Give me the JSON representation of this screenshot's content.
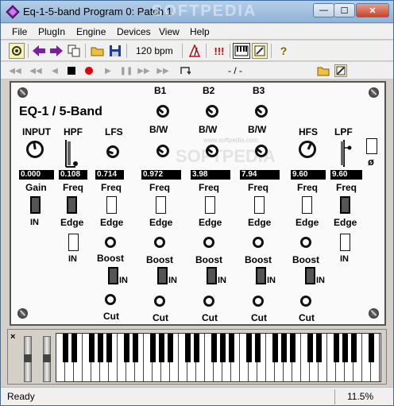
{
  "window": {
    "title": "Eq-1-5-band Program 0: Patch   1",
    "watermark": "SOFTPEDIA",
    "minimize_glyph": "—",
    "maximize_glyph": "☐",
    "close_glyph": "✕"
  },
  "menu": [
    "File",
    "PlugIn",
    "Engine",
    "Devices",
    "View",
    "Help"
  ],
  "toolbar": {
    "tempo": "120 bpm",
    "alert_label": "!!!"
  },
  "transport": {
    "position": "- / -"
  },
  "panel": {
    "title": "EQ-1 / 5-Band",
    "band_headers": [
      "B1",
      "B2",
      "B3"
    ],
    "labels": {
      "input": "INPUT",
      "hpf": "HPF",
      "lfs": "LFS",
      "bw": "B/W",
      "hfs": "HFS",
      "lpf": "LPF",
      "phase": "ø"
    },
    "values": [
      "0.000",
      "0.108",
      "0.714",
      "0.972",
      "3.98",
      "7.94",
      "9.60",
      "9.60"
    ],
    "param_labels": [
      "Gain",
      "Freq",
      "Freq",
      "Freq",
      "Freq",
      "Freq",
      "Freq",
      "Freq"
    ],
    "edge": "Edge",
    "in": "IN",
    "boost": "Boost",
    "cut": "Cut",
    "watermark": "SOFTPEDIA",
    "watermark_url": "www.softpedia.com"
  },
  "status": {
    "text": "Ready",
    "zoom": "11.5%"
  },
  "colors": {
    "titlebar_top": "#b6cfe8",
    "titlebar_bottom": "#8fb2d6",
    "close_button": "#c7432a",
    "arrow_purple": "#7a1fa0",
    "record_red": "#e00000",
    "alert_red": "#d40000"
  }
}
